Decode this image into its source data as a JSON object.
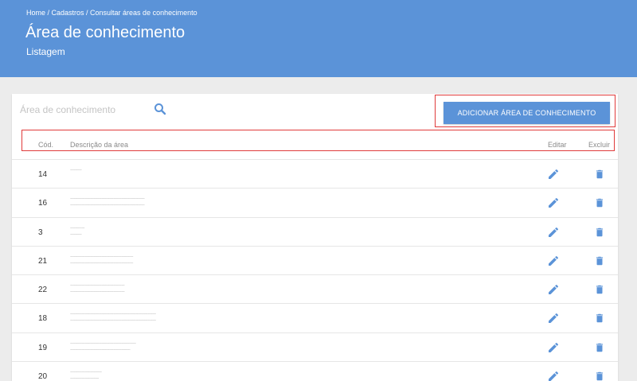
{
  "header": {
    "breadcrumb": "Home / Cadastros / Consultar áreas de conhecimento",
    "title": "Área de conhecimento",
    "subtitle": "Listagem"
  },
  "search": {
    "placeholder": "Área de conhecimento",
    "value": ""
  },
  "actions": {
    "add_label": "ADICIONAR ÁREA DE CONHECIMENTO"
  },
  "table": {
    "columns": {
      "cod": "Cód.",
      "desc": "Descrição da área",
      "edit": "Editar",
      "delete": "Excluir"
    },
    "rows": [
      {
        "cod": "14",
        "desc_line1": "~~~~",
        "desc_line2": ""
      },
      {
        "cod": "16",
        "desc_line1": "~~~~~~~~~~~~~~~~~~~~~~~~~~",
        "desc_line2": "~~~~~~~~~~~~~~~~~~~~~~~~~~"
      },
      {
        "cod": "3",
        "desc_line1": "~~~~~",
        "desc_line2": "~~~~"
      },
      {
        "cod": "21",
        "desc_line1": "~~~~~~~~~~~~~~~~~~~~~~",
        "desc_line2": "~~~~~~~~~~~~~~~~~~~~~~"
      },
      {
        "cod": "22",
        "desc_line1": "~~~~~~~~~~~~~~~~~~~",
        "desc_line2": "~~~~~~~~~~~~~~~~~~~"
      },
      {
        "cod": "18",
        "desc_line1": "~~~~~~~~~~~~~~~~~~~~~~~~~~~~~~",
        "desc_line2": "~~~~~~~~~~~~~~~~~~~~~~~~~~~~~~"
      },
      {
        "cod": "19",
        "desc_line1": "~~~~~~~~~~~~~~~~~~~~~~~",
        "desc_line2": "~~~~~~~~~~~~~~~~~~~~~"
      },
      {
        "cod": "20",
        "desc_line1": "~~~~~~~~~~~",
        "desc_line2": "~~~~~~~~~~"
      }
    ]
  },
  "icons": {
    "search": "search-icon",
    "edit": "pencil-icon",
    "delete": "trash-icon"
  },
  "colors": {
    "header_bg": "#5b93d8",
    "accent": "#5b93d8",
    "highlight_outline": "#e03b3b",
    "page_bg": "#ececec"
  }
}
